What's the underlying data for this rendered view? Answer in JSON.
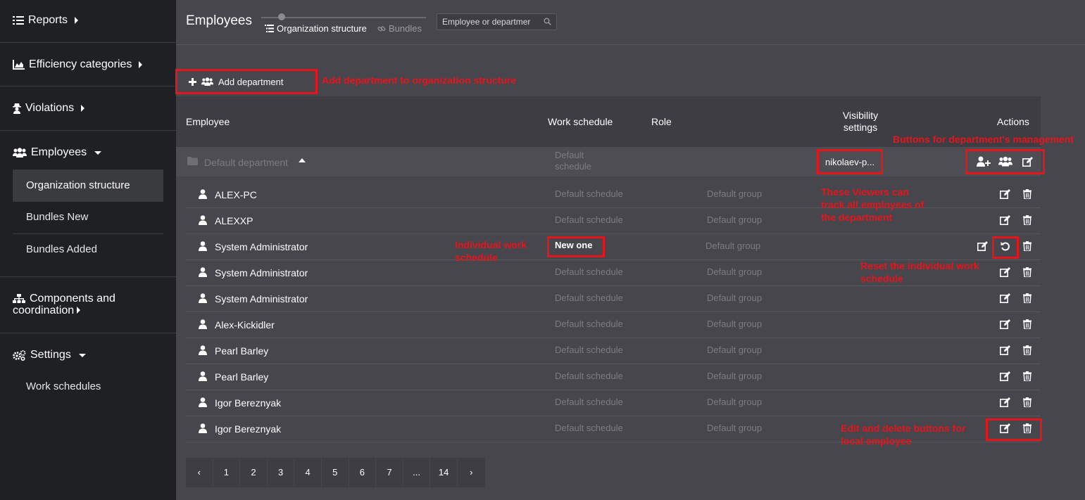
{
  "sidebar": {
    "sections": [
      {
        "label": "Reports",
        "icon": "list-icon"
      },
      {
        "label": "Efficiency categories",
        "icon": "area-chart-icon"
      },
      {
        "label": "Violations",
        "icon": "spy-icon"
      },
      {
        "label": "Employees",
        "icon": "users-icon"
      },
      {
        "label": "Components and",
        "label2": "coordination",
        "icon": "sitemap-icon"
      },
      {
        "label": "Settings",
        "icon": "gears-icon"
      }
    ],
    "employees_items": [
      "Organization structure",
      "Bundles New",
      "Bundles Added"
    ],
    "settings_items": [
      "Work schedules"
    ]
  },
  "header": {
    "title": "Employees",
    "tab_org": "Organization structure",
    "tab_bundles": "Bundles",
    "search_placeholder": "Employee or departmer"
  },
  "toolbar": {
    "add_department": "Add department"
  },
  "table": {
    "columns": {
      "employee": "Employee",
      "work_schedule": "Work schedule",
      "role": "Role",
      "visibility_1": "Visibility",
      "visibility_2": "settings",
      "actions": "Actions"
    },
    "department": {
      "name": "Default department",
      "schedule_1": "Default",
      "schedule_2": "schedule",
      "visibility": "nikolaev-p..."
    },
    "rows": [
      {
        "name": "ALEX-PC",
        "schedule": "Default schedule",
        "role": "Default group"
      },
      {
        "name": "ALEXXP",
        "schedule": "Default schedule",
        "role": "Default group"
      },
      {
        "name": "System Administrator",
        "schedule": "New one",
        "role": "Default group"
      },
      {
        "name": "System Administrator",
        "schedule": "Default schedule",
        "role": "Default group"
      },
      {
        "name": "System Administrator",
        "schedule": "Default schedule",
        "role": "Default group"
      },
      {
        "name": "Alex-Kickidler",
        "schedule": "Default schedule",
        "role": "Default group"
      },
      {
        "name": "Pearl Barley",
        "schedule": "Default schedule",
        "role": "Default group"
      },
      {
        "name": "Pearl Barley",
        "schedule": "Default schedule",
        "role": "Default group"
      },
      {
        "name": "Igor Bereznyak",
        "schedule": "Default schedule",
        "role": "Default group"
      },
      {
        "name": "Igor Bereznyak",
        "schedule": "Default schedule",
        "role": "Default group"
      }
    ]
  },
  "annotations": {
    "add_department": "Add department to organization structure",
    "dept_buttons": "Buttons for department's management",
    "viewers_1": "These Viewers can",
    "viewers_2": "track all employees of",
    "viewers_3": "the department",
    "individual_1": "Individual work",
    "individual_2": "schedule",
    "reset_1": "Reset the individual work",
    "reset_2": "schedule",
    "edit_delete_1": "Edit and delete buttons for",
    "edit_delete_2": "local employee"
  },
  "pagination": {
    "prev": "‹",
    "pages": [
      "1",
      "2",
      "3",
      "4",
      "5",
      "6",
      "7",
      "...",
      "14"
    ],
    "next": "›"
  },
  "colors": {
    "annotation": "#e8141b",
    "sidebar": "#1f2023",
    "main": "#46464c"
  }
}
